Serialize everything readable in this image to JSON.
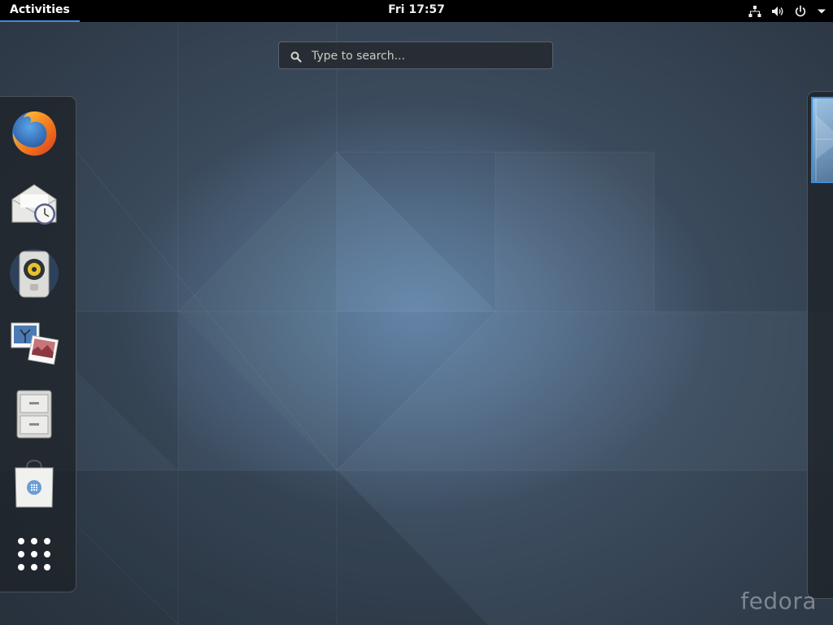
{
  "topbar": {
    "activities_label": "Activities",
    "clock": "Fri 17:57",
    "status_icons": [
      "network-wired-icon",
      "volume-icon",
      "power-icon",
      "menu-arrow-icon"
    ]
  },
  "search": {
    "placeholder": "Type to search..."
  },
  "dash": {
    "items": [
      {
        "name": "Firefox",
        "icon": "firefox-icon"
      },
      {
        "name": "Evolution",
        "icon": "mail-clock-icon"
      },
      {
        "name": "Rhythmbox",
        "icon": "speaker-icon"
      },
      {
        "name": "Shotwell",
        "icon": "photos-icon"
      },
      {
        "name": "Files",
        "icon": "file-cabinet-icon"
      },
      {
        "name": "Software",
        "icon": "software-bag-icon"
      },
      {
        "name": "Show Applications",
        "icon": "app-grid-icon"
      }
    ]
  },
  "watermark": "fedora",
  "colors": {
    "topbar": "#000000",
    "accent": "#3d8ee0",
    "text": "#eeeeec"
  }
}
